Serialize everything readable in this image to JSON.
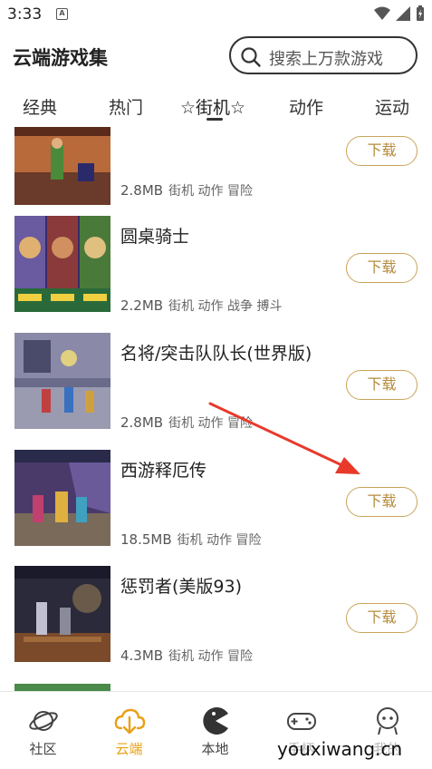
{
  "status": {
    "time": "3:33",
    "notif_letter": "A"
  },
  "header": {
    "title": "云端游戏集",
    "search_placeholder": "搜索上万款游戏"
  },
  "tabs": [
    "经典",
    "热门",
    "☆街机☆",
    "动作",
    "运动"
  ],
  "games": [
    {
      "name": "",
      "size": "2.8MB",
      "tags": "街机 动作 冒险",
      "button": "下载"
    },
    {
      "name": "圆桌骑士",
      "size": "2.2MB",
      "tags": "街机 动作 战争 搏斗",
      "button": "下载"
    },
    {
      "name": "名将/突击队队长(世界版)",
      "size": "2.8MB",
      "tags": "街机 动作 冒险",
      "button": "下载"
    },
    {
      "name": "西游释厄传",
      "size": "18.5MB",
      "tags": "街机 动作 冒险",
      "button": "下载"
    },
    {
      "name": "惩罚者(美版93)",
      "size": "4.3MB",
      "tags": "街机 动作 冒险",
      "button": "下载"
    }
  ],
  "bottom_nav": [
    {
      "label": "社区",
      "icon": "planet-icon"
    },
    {
      "label": "云端",
      "icon": "cloud-download-icon"
    },
    {
      "label": "本地",
      "icon": "pacman-icon"
    },
    {
      "label": "手柄",
      "icon": "gamepad-icon"
    },
    {
      "label": "我的",
      "icon": "profile-icon"
    }
  ],
  "colors": {
    "accent": "#e8a015",
    "button_border": "#c9a45a",
    "arrow": "#e8392b"
  },
  "watermark": "youxiwang.cn"
}
